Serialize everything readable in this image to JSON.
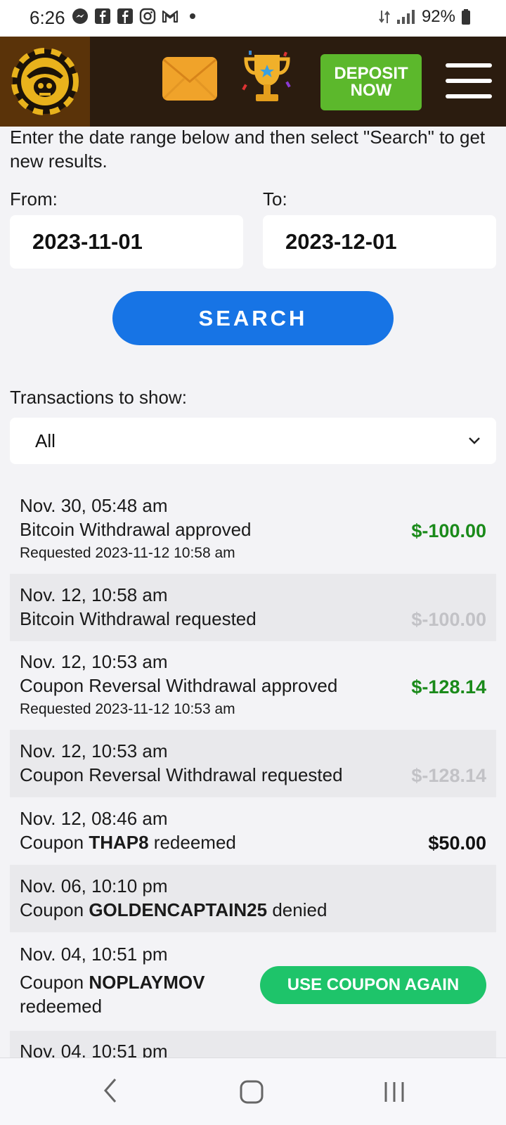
{
  "status": {
    "time": "6:26",
    "notifications": [
      "messenger-icon",
      "facebook-icon",
      "facebook-icon",
      "instagram-icon",
      "gmail-icon",
      "dot-icon"
    ],
    "battery": "92%"
  },
  "header": {
    "deposit_line1": "DEPOSIT",
    "deposit_line2": "NOW"
  },
  "intro": "Enter the date range below and then select \"Search\" to get new results.",
  "filter": {
    "from_label": "From:",
    "from_value": "2023-11-01",
    "to_label": "To:",
    "to_value": "2023-12-01",
    "search_label": "SEARCH",
    "show_label": "Transactions to show:",
    "show_value": "All"
  },
  "transactions": [
    {
      "date": "Nov. 30, 05:48 am",
      "desc": "Bitcoin Withdrawal approved",
      "sub": "Requested 2023-11-12 10:58 am",
      "amount": "$-100.00"
    },
    {
      "date": "Nov. 12, 10:58 am",
      "desc": "Bitcoin Withdrawal requested",
      "amount": "$-100.00"
    },
    {
      "date": "Nov. 12, 10:53 am",
      "desc": "Coupon Reversal Withdrawal approved",
      "sub": "Requested 2023-11-12 10:53 am",
      "amount": "$-128.14"
    },
    {
      "date": "Nov. 12, 10:53 am",
      "desc": "Coupon Reversal Withdrawal requested",
      "amount": "$-128.14"
    },
    {
      "date": "Nov. 12, 08:46 am",
      "pre": "Coupon",
      "code": "THAP8",
      "post": "redeemed",
      "amount": "$50.00"
    },
    {
      "date": "Nov. 06, 10:10 pm",
      "pre": "Coupon",
      "code": "GOLDENCAPTAIN25",
      "post": "denied"
    },
    {
      "date": "Nov. 04, 10:51 pm",
      "pre": "Coupon",
      "code": "NOPLAYMOV",
      "post": "redeemed",
      "button": "USE COUPON AGAIN"
    },
    {
      "date": "Nov. 04, 10:51 pm"
    }
  ],
  "colors": {
    "accent_blue": "#1774e5",
    "approved_green": "#1a8a1a",
    "pending_grey": "#c2c2c6",
    "coupon_green": "#1ec46a",
    "deposit_green": "#5cb82c",
    "header_brown": "#2b1c0f"
  }
}
